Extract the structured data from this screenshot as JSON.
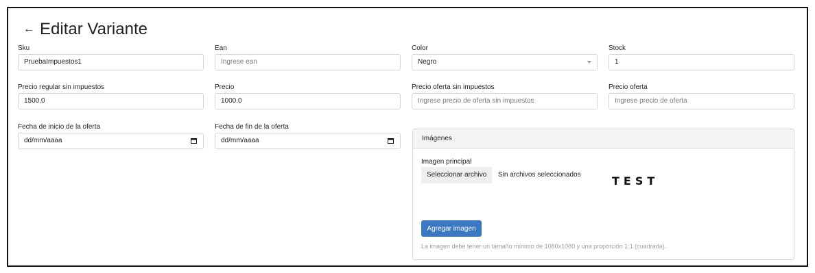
{
  "page": {
    "title": "Editar Variante",
    "back_icon": "arrow-left-icon"
  },
  "fields": {
    "sku": {
      "label": "Sku",
      "value": "PruebaImpuestos1"
    },
    "ean": {
      "label": "Ean",
      "placeholder": "Ingrese ean"
    },
    "color": {
      "label": "Color",
      "selected": "Negro"
    },
    "stock": {
      "label": "Stock",
      "value": "1"
    },
    "precio_regular": {
      "label": "Precio regular sin impuestos",
      "value": "1500.0"
    },
    "precio": {
      "label": "Precio",
      "value": "1000.0"
    },
    "precio_oferta_sin": {
      "label": "Precio oferta sin impuestos",
      "placeholder": "Ingrese precio de oferta sin impuestos"
    },
    "precio_oferta": {
      "label": "Precio oferta",
      "placeholder": "Ingrese precio de oferta"
    },
    "fecha_inicio": {
      "label": "Fecha de inicio de la oferta",
      "value": "dd/mm/aaaa"
    },
    "fecha_fin": {
      "label": "Fecha de fin de la oferta",
      "value": "dd/mm/aaaa"
    }
  },
  "images": {
    "header": "Imágenes",
    "main_label": "Imagen principal",
    "file_button": "Seleccionar archivo",
    "file_status": "Sin archivos seleccionados",
    "preview_text": "TEST",
    "add_button": "Agregar imagen",
    "help": "La imagen debe tener un tamaño mínimo de 1080x1080 y una proporción 1:1 (cuadrada)."
  },
  "colors": {
    "primary": "#3a78c2",
    "border": "#d5d5d5",
    "card_header_bg": "#f4f4f4",
    "muted_text": "#9aa0a6"
  }
}
